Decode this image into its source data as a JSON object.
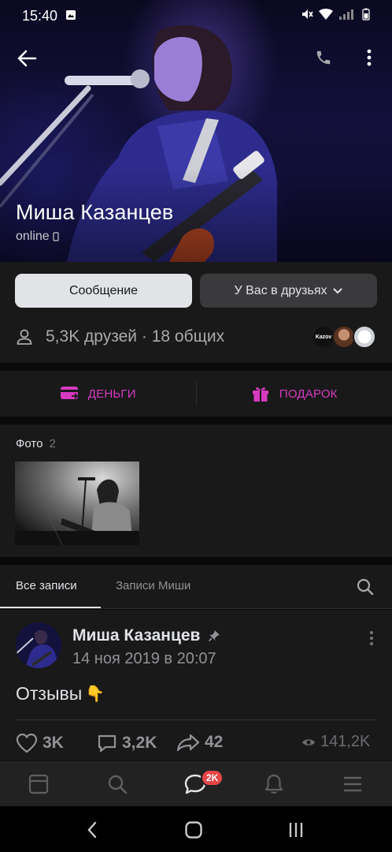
{
  "status_bar": {
    "time": "15:40"
  },
  "profile": {
    "name": "Миша Казанцев",
    "status": "online"
  },
  "actions": {
    "message_label": "Сообщение",
    "friend_status_label": "У Вас в друзьях",
    "friends_info": "5,3K друзей · 18 общих",
    "mutual_avatar_text": "Kazov"
  },
  "payments": {
    "money_label": "ДЕНЬГИ",
    "gift_label": "ПОДАРОК"
  },
  "photos": {
    "title": "Фото",
    "count": "2"
  },
  "wall": {
    "tabs": [
      {
        "label": "Все записи"
      },
      {
        "label": "Записи Миши"
      }
    ]
  },
  "post": {
    "author": "Миша Казанцев",
    "date": "14 ноя 2019 в 20:07",
    "text": "Отзывы",
    "emoji": "👇",
    "likes": "3K",
    "comments": "3,2K",
    "shares": "42",
    "views": "141,2K"
  },
  "tabbar": {
    "messages_badge": "2K"
  },
  "colors": {
    "accent_magenta": "#d63ac0",
    "badge_red": "#e64646",
    "background": "#19191a",
    "primary_button": "#e1e3e6"
  },
  "icons": [
    "back-arrow-icon",
    "phone-icon",
    "more-vertical-icon",
    "person-icon",
    "wallet-icon",
    "gift-icon",
    "search-icon",
    "pin-icon",
    "heart-icon",
    "comment-icon",
    "share-icon",
    "eye-icon",
    "news-icon",
    "messages-icon",
    "bell-icon",
    "menu-icon"
  ]
}
